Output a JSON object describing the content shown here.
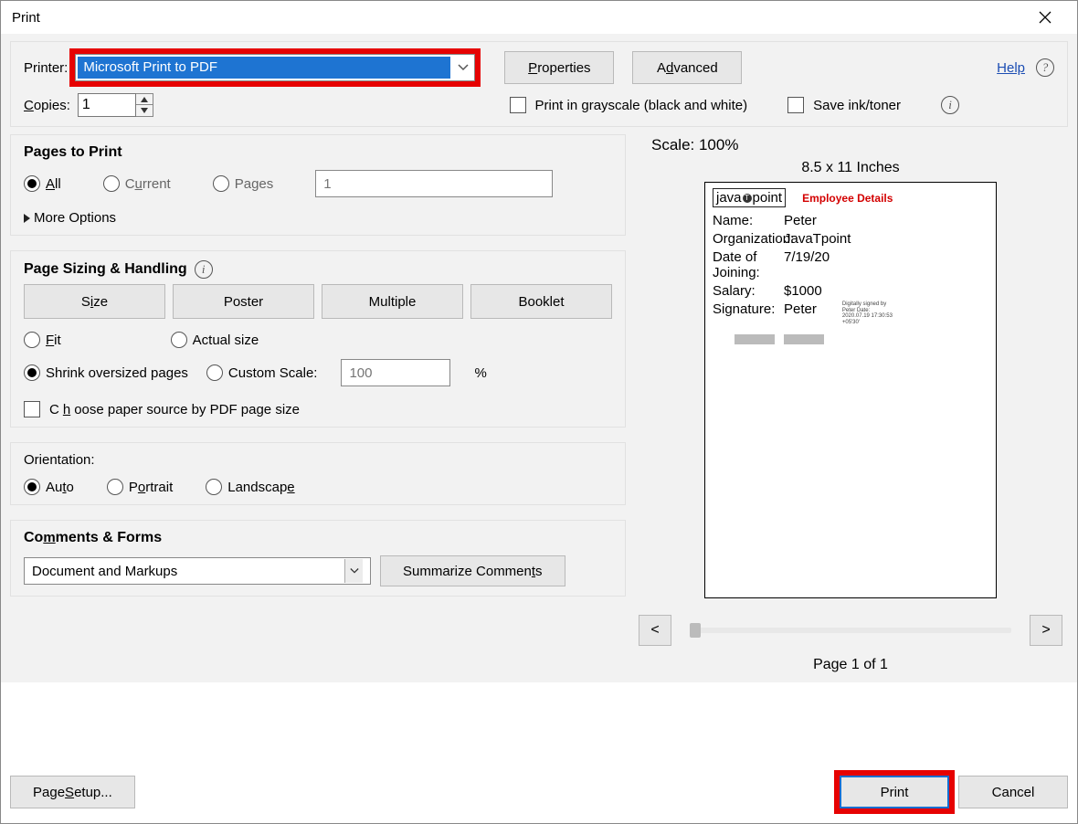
{
  "titlebar": {
    "title": "Print"
  },
  "top": {
    "printer_label": "Printer:",
    "printer_value": "Microsoft Print to PDF",
    "properties": "Properties",
    "advanced": "Advanced",
    "help": "Help",
    "copies_label": "Copies:",
    "copies_value": "1",
    "grayscale": "Print in grayscale (black and white)",
    "inktoner": "Save ink/toner"
  },
  "pages": {
    "title": "Pages to Print",
    "all": "All",
    "current": "Current",
    "pages": "Pages",
    "range_placeholder": "1",
    "more": "More Options"
  },
  "sizing": {
    "title": "Page Sizing & Handling",
    "tabs": {
      "size": "Size",
      "poster": "Poster",
      "multiple": "Multiple",
      "booklet": "Booklet"
    },
    "fit": "Fit",
    "actual": "Actual size",
    "shrink": "Shrink oversized pages",
    "custom": "Custom Scale:",
    "custom_value": "100",
    "custom_pct": "%",
    "paper_source": "Choose paper source by PDF page size"
  },
  "orientation": {
    "title": "Orientation:",
    "auto": "Auto",
    "portrait": "Portrait",
    "landscape": "Landscape"
  },
  "comments": {
    "title": "Comments & Forms",
    "value": "Document and Markups",
    "summarize": "Summarize Comments"
  },
  "preview": {
    "scale": "Scale: 100%",
    "dims": "8.5 x 11 Inches",
    "page_of": "Page 1 of 1",
    "prev": "<",
    "next": ">",
    "doc": {
      "logo_a": "java",
      "logo_b": "T",
      "logo_c": "point",
      "title": "Employee Details",
      "rows": [
        {
          "l": "Name:",
          "v": "Peter"
        },
        {
          "l": "Organization:",
          "v": "JavaTpoint"
        },
        {
          "l": "Date of Joining:",
          "v": "7/19/20"
        },
        {
          "l": "Salary:",
          "v": "$1000"
        },
        {
          "l": "Signature:",
          "v": "Peter"
        }
      ],
      "sig_note": "Digitally signed by Peter\nDate: 2020.07.19 17:30:53\n+05'30'"
    }
  },
  "footer": {
    "page_setup": "Page Setup...",
    "print": "Print",
    "cancel": "Cancel"
  }
}
